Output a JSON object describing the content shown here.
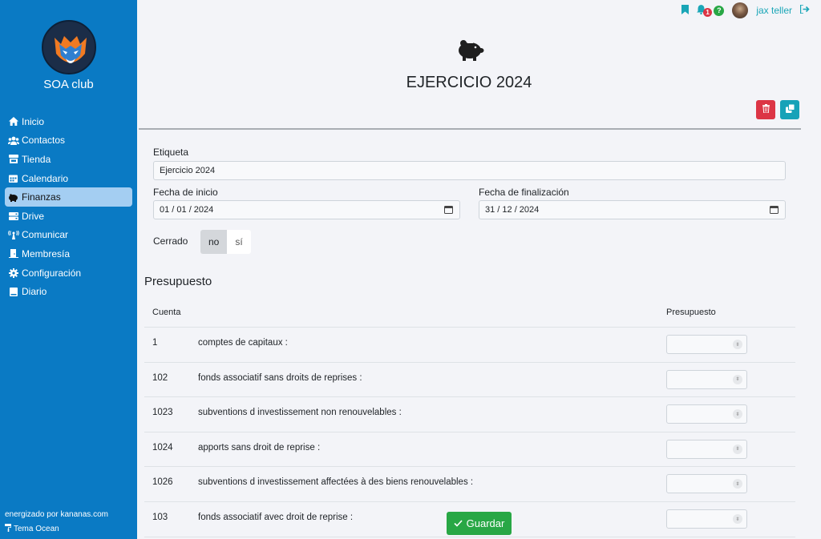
{
  "sidebar": {
    "club_name": "SOA club",
    "items": [
      {
        "label": "Inicio",
        "icon": "home-icon"
      },
      {
        "label": "Contactos",
        "icon": "users-icon"
      },
      {
        "label": "Tienda",
        "icon": "store-icon"
      },
      {
        "label": "Calendario",
        "icon": "calendar-icon"
      },
      {
        "label": "Finanzas",
        "icon": "piggy-bank-icon",
        "active": true
      },
      {
        "label": "Drive",
        "icon": "drive-icon"
      },
      {
        "label": "Comunicar",
        "icon": "broadcast-icon"
      },
      {
        "label": "Membresía",
        "icon": "door-icon"
      },
      {
        "label": "Configuración",
        "icon": "gear-icon"
      },
      {
        "label": "Diario",
        "icon": "book-icon"
      }
    ],
    "powered_by": "energizado por kananas.com",
    "theme": "Tema Ocean"
  },
  "topbar": {
    "notification_count": "1",
    "help_glyph": "?",
    "user_name": "jax teller"
  },
  "page": {
    "title": "EJERCICIO 2024"
  },
  "form": {
    "label_etiqueta": "Etiqueta",
    "etiqueta_value": "Ejercicio 2024",
    "label_inicio": "Fecha de inicio",
    "inicio_value": "01 / 01 / 2024",
    "label_fin": "Fecha de finalización",
    "fin_value": "31 / 12 / 2024",
    "label_cerrado": "Cerrado",
    "cerrado_no": "no",
    "cerrado_si": "sí"
  },
  "budget": {
    "title": "Presupuesto",
    "col_cuenta": "Cuenta",
    "col_presupuesto": "Presupuesto",
    "rows": [
      {
        "code": "1",
        "name": "comptes de capitaux :"
      },
      {
        "code": "102",
        "name": "fonds associatif sans droits de reprises :"
      },
      {
        "code": "1023",
        "name": "subventions d investissement non renouvelables :"
      },
      {
        "code": "1024",
        "name": "apports sans droit de reprise :"
      },
      {
        "code": "1026",
        "name": "subventions d investissement affectées à des biens renouvelables :"
      },
      {
        "code": "103",
        "name": "fonds associatif avec droit de reprise :"
      }
    ]
  },
  "actions": {
    "save_label": "Guardar"
  },
  "colors": {
    "sidebar": "#0a7ac4",
    "active_item": "#a4cef2",
    "danger": "#dc3545",
    "info": "#17a2b8",
    "success": "#28a745"
  }
}
